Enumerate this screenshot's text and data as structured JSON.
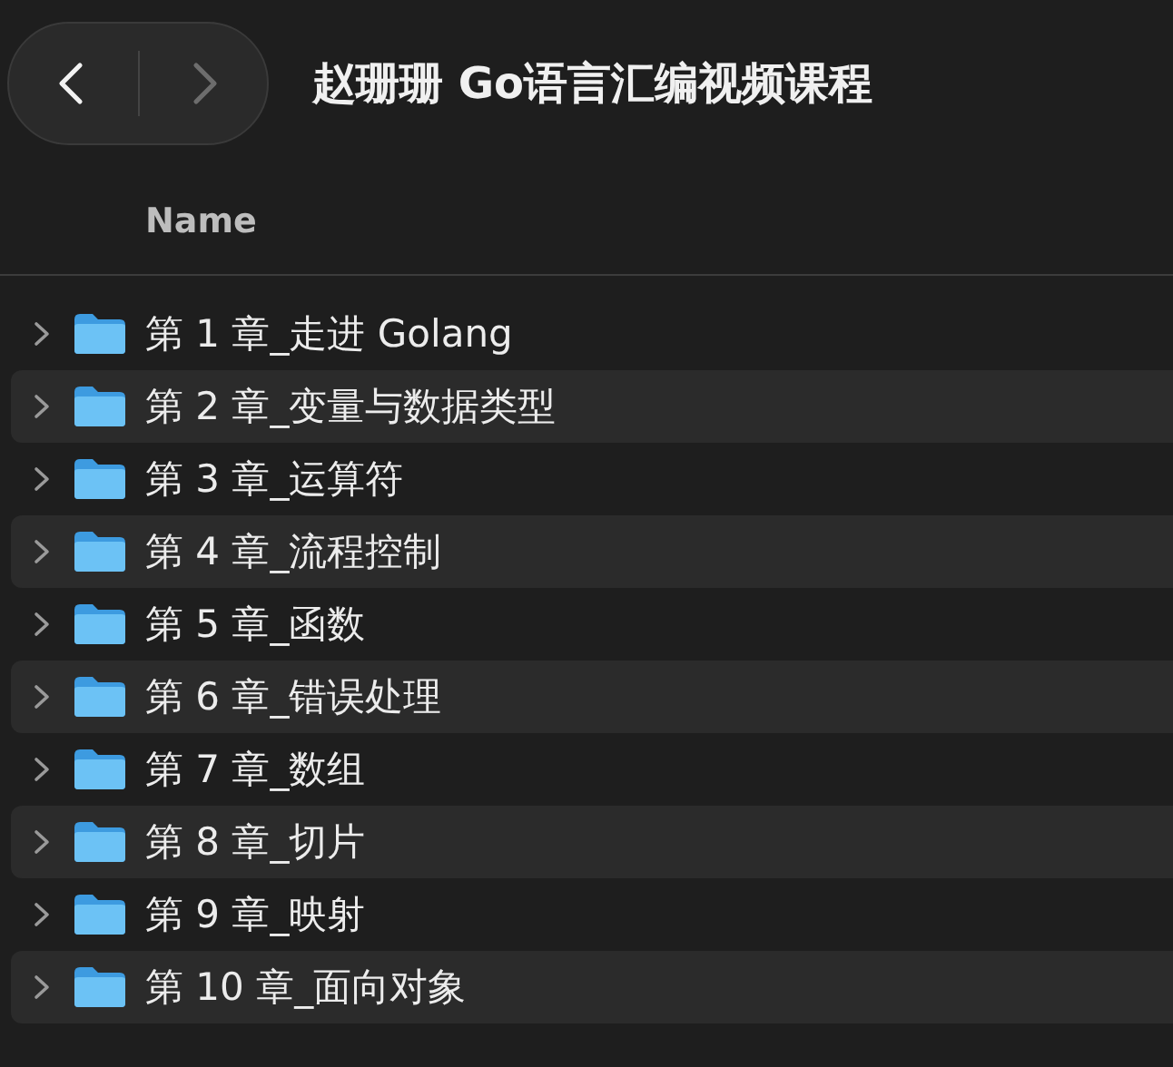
{
  "toolbar": {
    "nav_buttons": [
      {
        "kind": "back",
        "disabled": false
      },
      {
        "kind": "forward",
        "disabled": true
      }
    ],
    "title": "赵珊珊 Go语言汇编视频课程"
  },
  "columns": [
    {
      "label": "Name"
    }
  ],
  "rows": [
    {
      "name": "第 1 章_走进 Golang",
      "expanded": false
    },
    {
      "name": "第 2 章_变量与数据类型",
      "expanded": false
    },
    {
      "name": "第 3 章_运算符",
      "expanded": false
    },
    {
      "name": "第 4 章_流程控制",
      "expanded": false
    },
    {
      "name": "第 5 章_函数",
      "expanded": false
    },
    {
      "name": "第 6 章_错误处理",
      "expanded": false
    },
    {
      "name": "第 7 章_数组",
      "expanded": false
    },
    {
      "name": "第 8 章_切片",
      "expanded": false
    },
    {
      "name": "第 9 章_映射",
      "expanded": false
    },
    {
      "name": "第 10 章_面向对象",
      "expanded": false
    }
  ]
}
